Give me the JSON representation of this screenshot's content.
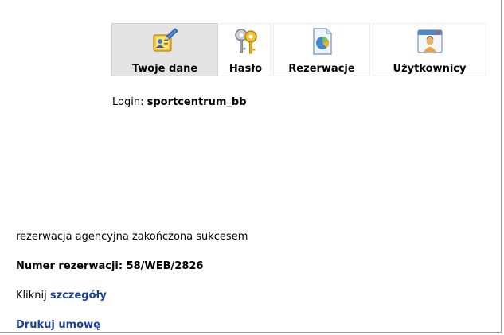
{
  "toolbar": {
    "items": [
      {
        "label": "Twoje dane",
        "icon": "user-card-edit-icon",
        "active": true
      },
      {
        "label": "Hasło",
        "icon": "keys-icon",
        "active": false
      },
      {
        "label": "Rezerwacje",
        "icon": "document-chart-icon",
        "active": false
      },
      {
        "label": "Użytkownicy",
        "icon": "user-window-icon",
        "active": false
      }
    ]
  },
  "login": {
    "label": "Login:",
    "value": "sportcentrum_bb"
  },
  "result": {
    "status": "rezerwacja agencyjna zakończona sukcesem",
    "number_text": "Numer rezerwacji: 58/WEB/2826",
    "details_prefix": "Kliknij",
    "details_link": "szczegóły",
    "print_link": "Drukuj umowę"
  },
  "colors": {
    "link": "#1a3f9a",
    "active_tab_bg": "#e4e4e4",
    "border": "#9a9a9a"
  }
}
